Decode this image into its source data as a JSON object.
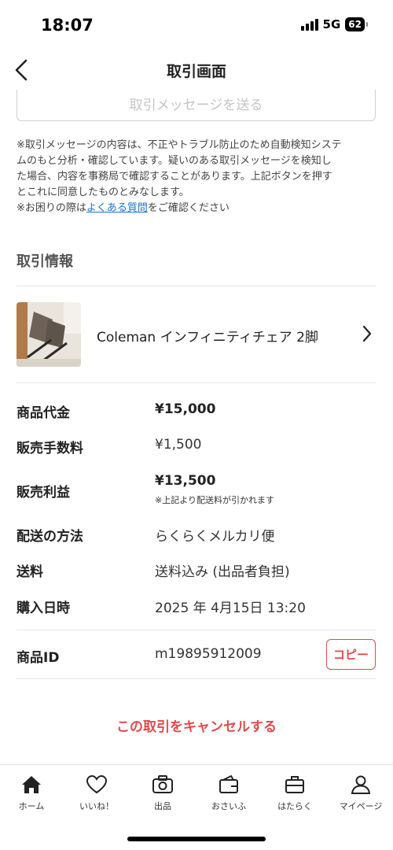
{
  "status": {
    "time": "18:07",
    "network": "5G",
    "battery": "62"
  },
  "nav": {
    "title": "取引画面"
  },
  "message": {
    "send_label": "取引メッセージを送る"
  },
  "notice": {
    "line1": "※取引メッセージの内容は、不正やトラブル防止のため自動検知システ",
    "line2": "ムのもと分析・確認しています。疑いのある取引メッセージを検知し",
    "line3": "た場合、内容を事務局で確認することがあります。上記ボタンを押す",
    "line4": "とこれに同意したものとみなします。",
    "faq_prefix": "※お困りの際は",
    "faq_link": "よくある質問",
    "faq_suffix": "をご確認ください"
  },
  "section": {
    "title": "取引情報"
  },
  "item": {
    "name": "Coleman インフィニティチェア 2脚"
  },
  "details": {
    "price_label": "商品代金",
    "price_value": "¥15,000",
    "fee_label": "販売手数料",
    "fee_value": "¥1,500",
    "profit_label": "販売利益",
    "profit_value": "¥13,500",
    "profit_note": "※上記より配送料が引かれます",
    "shipping_method_label": "配送の方法",
    "shipping_method_value": "らくらくメルカリ便",
    "shipping_fee_label": "送料",
    "shipping_fee_value": "送料込み (出品者負担)",
    "purchase_date_label": "購入日時",
    "purchase_date_value": "2025 年 4月15日 13:20",
    "item_id_label": "商品ID",
    "item_id_value": "m19895912009",
    "copy_label": "コピー"
  },
  "cancel": {
    "label": "この取引をキャンセルする"
  },
  "tabs": [
    {
      "label": "ホーム",
      "icon": "home-icon"
    },
    {
      "label": "いいね！",
      "icon": "heart-icon"
    },
    {
      "label": "出品",
      "icon": "camera-icon"
    },
    {
      "label": "おさいふ",
      "icon": "wallet-icon"
    },
    {
      "label": "はたらく",
      "icon": "briefcase-icon"
    },
    {
      "label": "マイページ",
      "icon": "person-icon"
    }
  ],
  "colors": {
    "accent": "#e04b4b",
    "link": "#1a73c9"
  }
}
